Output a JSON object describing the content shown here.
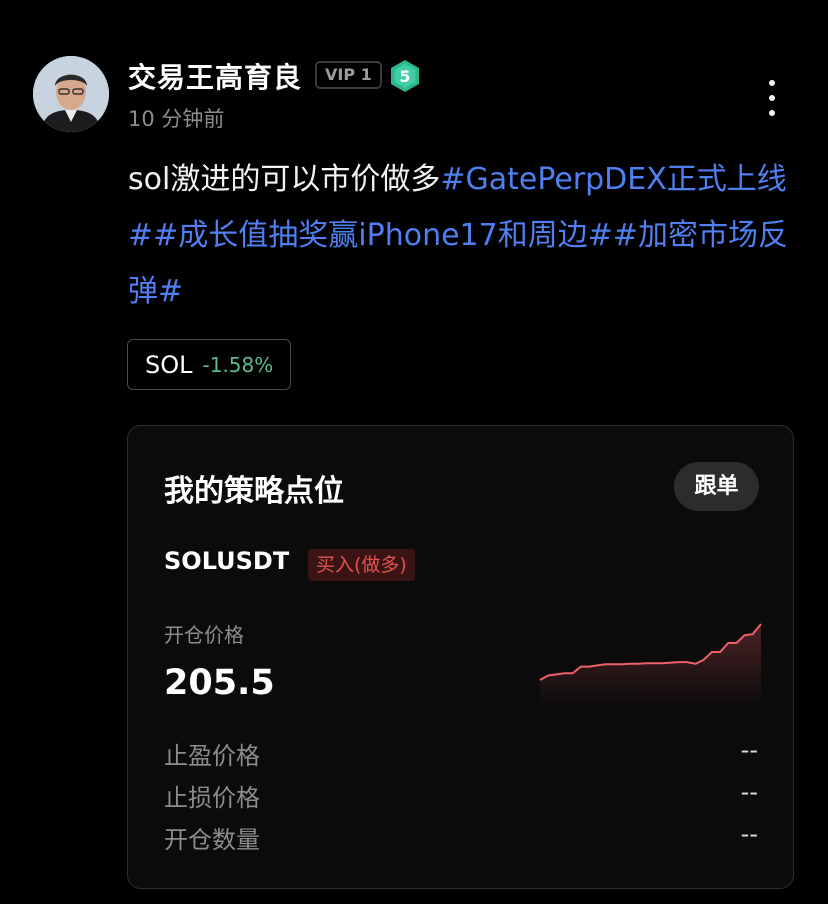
{
  "post": {
    "author": "交易王高育良",
    "vip_label": "VIP 1",
    "level": "5",
    "time": "10 分钟前",
    "text_prefix": "sol激进的可以市价做多",
    "hashtags": [
      "#GatePerpDEX正式上线#",
      "#成长值抽奖赢iPhone17和周边#",
      "#加密市场反弹#"
    ]
  },
  "coin_chip": {
    "symbol": "SOL",
    "change": "-1.58%"
  },
  "strategy": {
    "title": "我的策略点位",
    "follow_label": "跟单",
    "pair": "SOLUSDT",
    "side": "买入(做多)",
    "entry_label": "开仓价格",
    "entry_value": "205.5",
    "rows": [
      {
        "label": "止盈价格",
        "value": "--"
      },
      {
        "label": "止损价格",
        "value": "--"
      },
      {
        "label": "开仓数量",
        "value": "--"
      }
    ],
    "sparkline_values": [
      0,
      4,
      5,
      6,
      6,
      12,
      12,
      13,
      14,
      14,
      14,
      14.5,
      14.5,
      15,
      15,
      15,
      15.5,
      16,
      16,
      14.5,
      18,
      25,
      25,
      33,
      33,
      40,
      41,
      50
    ],
    "sparkline_color": "#f0606a"
  },
  "colors": {
    "hashtag": "#4f7ff0",
    "positive": "#5fbb8a",
    "buy_tag": "#e0514f",
    "level_badge": "#2fb58f"
  }
}
